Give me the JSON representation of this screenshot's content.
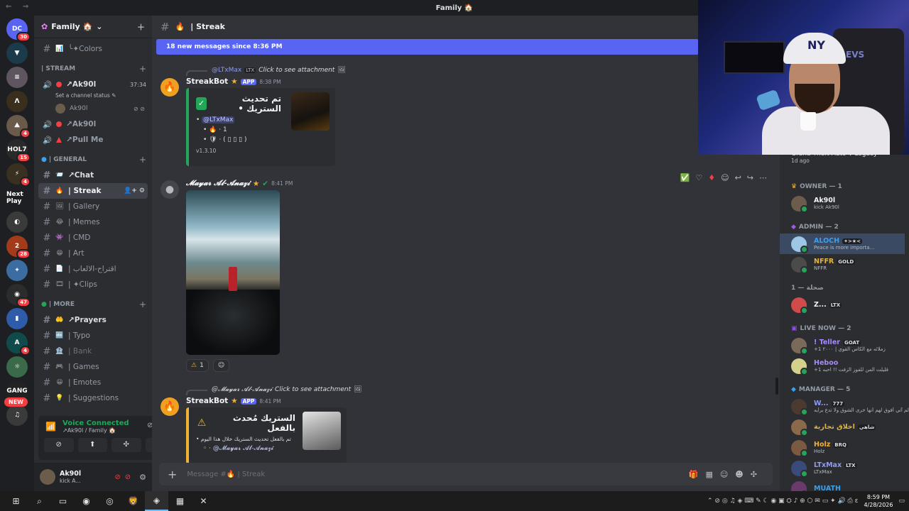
{
  "window": {
    "title": "Family 🏠",
    "nav": "← →"
  },
  "servers": [
    {
      "label": "DC",
      "color": "#5865f2",
      "badge": "30"
    },
    {
      "label": "▼",
      "color": "#1b3b4a",
      "badge": ""
    },
    {
      "label": "≡",
      "color": "#5e5560",
      "badge": ""
    },
    {
      "label": "Λ",
      "color": "#3a2e1c",
      "badge": ""
    },
    {
      "label": "⛰",
      "color": "#6a5a4a",
      "badge": "4"
    },
    {
      "label": "HOL7",
      "color": "#2a2a2a",
      "badge": "15"
    },
    {
      "label": "⚡",
      "color": "#3a3020",
      "badge": "4"
    },
    {
      "label": "Next Play",
      "color": "#1e1f22",
      "badge": ""
    },
    {
      "label": "◐",
      "color": "#3a3a3a",
      "badge": ""
    },
    {
      "label": "2",
      "color": "#a33b1a",
      "badge": "28"
    },
    {
      "label": "✦",
      "color": "#3b6da3",
      "badge": ""
    },
    {
      "label": "◉",
      "color": "#2c2c2c",
      "badge": "47"
    },
    {
      "label": "▮",
      "color": "#2e5ca8",
      "badge": ""
    },
    {
      "label": "A",
      "color": "#0f4b4a",
      "badge": "4"
    },
    {
      "label": "☼",
      "color": "#3a6a4a",
      "badge": ""
    },
    {
      "label": "GANG",
      "color": "#222",
      "badge": ""
    },
    {
      "label": "♫",
      "color": "#3a3a3a",
      "badge": ""
    }
  ],
  "new_badge": "NEW",
  "guild": {
    "name": "Family 🏠",
    "icon": "✿",
    "chevron": "⌄",
    "add_icon": "＋"
  },
  "channels_top": [
    {
      "emoji": "📊",
      "name": "╰✦Colors"
    }
  ],
  "stream_cat": "| STREAM",
  "voice_stream": {
    "name": "↗Ak90l",
    "time": "37:34",
    "status": "Set a channel status ✎",
    "user": "Ak90l",
    "channel2": "↗Ak90l",
    "channel3": "↗Pull Me"
  },
  "general_cat": "| GENERAL",
  "general_channels": [
    {
      "emoji": "📨",
      "name": "↗Chat"
    },
    {
      "emoji": "🔥",
      "name": "| Streak"
    },
    {
      "emoji": "🖼",
      "name": "| Gallery"
    },
    {
      "emoji": "😂",
      "name": "| Memes"
    },
    {
      "emoji": "👾",
      "name": "| CMD"
    },
    {
      "emoji": "😁",
      "name": "| Art"
    },
    {
      "emoji": "📄",
      "name": "| اقتراح-الالعاب"
    },
    {
      "emoji": "🎞",
      "name": "| ✦Clips"
    }
  ],
  "more_cat": "| MORE",
  "more_channels": [
    {
      "emoji": "🤲",
      "name": "↗Prayers"
    },
    {
      "emoji": "🔤",
      "name": "| Typo"
    },
    {
      "emoji": "🏦",
      "name": "| Bank"
    },
    {
      "emoji": "🎮",
      "name": "| Games"
    },
    {
      "emoji": "😀",
      "name": "| Emotes"
    },
    {
      "emoji": "💡",
      "name": "| Suggestions"
    }
  ],
  "voice_panel": {
    "title": "Voice Connected",
    "sub": "↗Ak90l / Family 🏠"
  },
  "user_panel": {
    "name": "Ak90l",
    "status": "kick A..."
  },
  "channel_header": {
    "name": "| Streak",
    "emoji": "🔥"
  },
  "new_messages": "18 new messages since 8:36 PM",
  "msg1": {
    "reply_user": "@LTxMax",
    "reply_tag": "LTX",
    "reply_text": "Click to see attachment",
    "author": "StreakBot",
    "app": "APP",
    "time": "8:38 PM",
    "embed_title": "تم تحديث الستريك •",
    "embed_mention": "@LTxMax",
    "embed_line1": "• 🔥 · 1",
    "embed_line2": "• 🛡 · ( ▯ ▯ ▯ )",
    "embed_footer": "v1.3.10"
  },
  "msg2": {
    "author": "𝓜𝓪𝔂𝓪𝓻 𝓐𝓵-𝓐𝓷𝓪𝔃𝓲",
    "time": "8:41 PM",
    "reaction_count": "1"
  },
  "msg3": {
    "reply_user": "@𝓜𝓪𝔂𝓪𝓻 𝓐𝓵-𝓐𝓷𝓪𝔃𝓲",
    "reply_text": "Click to see attachment",
    "author": "StreakBot",
    "app": "APP",
    "time": "8:41 PM",
    "embed_title": "الستريك مُحدث بالفعل",
    "embed_line1": "• تم بالفعل تحديث الستريك خلال هذا اليوم",
    "embed_line2": "◦ · @𝓜𝓪𝔂𝓪𝓻 𝓐𝓵-𝓐𝓷𝓪𝔃𝓲"
  },
  "composer_placeholder": "Message #🔥 | Streak",
  "members": {
    "game": "Grand Theft Auto V Legacy",
    "game_ago": "1d ago",
    "owner_cat": "OWNER — 1",
    "owner": [
      {
        "name": "Ak90l",
        "tag": "",
        "status": "kick Ak90l",
        "color": "#f2f3f5",
        "av": "#6b5c4b"
      }
    ],
    "admin_cat": "ADMIN — 2",
    "admin": [
      {
        "name": "ALOCH",
        "tag": "✦>★<",
        "status": "Peace is more importa...",
        "color": "#3aa1f0",
        "av": "#9ec6e6"
      },
      {
        "name": "NFFR",
        "tag": "GOLD",
        "status": "NFFR",
        "color": "#e3b341",
        "av": "#4b4b4b"
      }
    ],
    "salah_cat": "صحلة — 1",
    "salah": [
      {
        "name": "Z...",
        "tag": "LTX",
        "status": "",
        "color": "#f2f3f5",
        "av": "#d24b4b"
      }
    ],
    "live_cat": "LIVE NOW — 2",
    "live": [
      {
        "name": "! Teller",
        "tag": "GOAT",
        "status": "+1 زملائه مع الكاس القوي | ٢٠٠٠",
        "color": "#a78bfa",
        "av": "#7b6a5a"
      },
      {
        "name": "Heboo",
        "tag": "",
        "status": "+1 قليلت المن للفوز الزفت !! احبه",
        "color": "#a78bfa",
        "av": "#d5d08a"
      }
    ],
    "manager_cat": "MANAGER — 5",
    "manager": [
      {
        "name": "W...",
        "tag": "777",
        "status": "لم آتي أفوق لهم أنها خرى الشوق ولا تدع برأيه",
        "color": "#8e9cf5",
        "av": "#4a3a30"
      },
      {
        "name": "اخلاق تجارية",
        "tag": "شاهي",
        "status": "",
        "color": "#e3b341",
        "av": "#8a6a4a"
      },
      {
        "name": "Holz",
        "tag": "BRQ",
        "status": "Holz",
        "color": "#f0b232",
        "av": "#7a5a40"
      },
      {
        "name": "LTxMax",
        "tag": "LTX",
        "status": "LTxMax",
        "color": "#8e9cf5",
        "av": "#3a4a7a"
      },
      {
        "name": "MUATH",
        "tag": "",
        "status": "",
        "color": "#3aa1f0",
        "av": "#6a3a6a"
      }
    ]
  },
  "webcam": {
    "cap": "NY",
    "bg_text": "EVS"
  },
  "taskbar": {
    "apps": [
      "⊞",
      "⌕",
      "▭",
      "◉",
      "◎",
      "🦁",
      "◈",
      "▦",
      "✕"
    ],
    "time": "8:59 PM",
    "date": "4/28/2026"
  }
}
